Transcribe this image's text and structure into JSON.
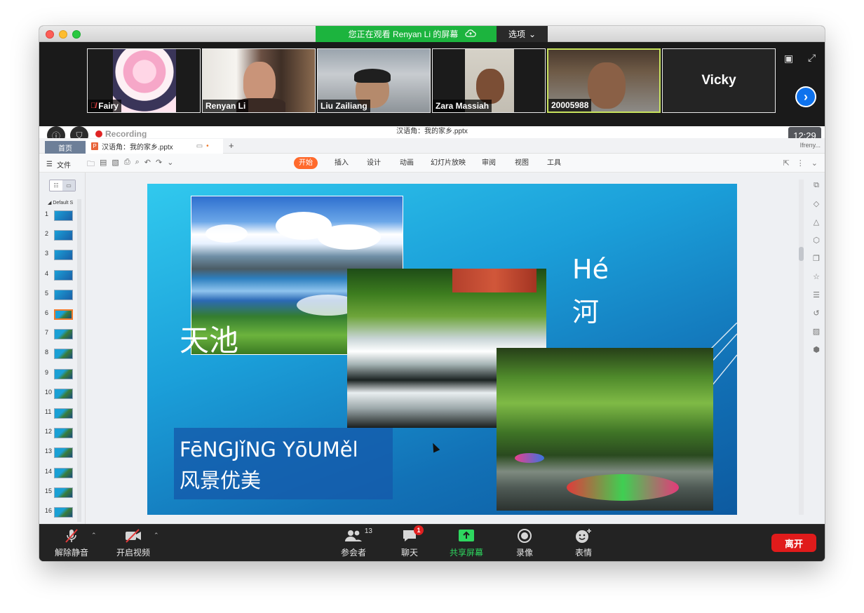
{
  "share_banner": {
    "text": "您正在观看 Renyan Li 的屏幕",
    "options_label": "选项"
  },
  "gallery": {
    "participants": [
      {
        "name": "Fairy",
        "muted": true
      },
      {
        "name": "Renyan Li",
        "muted": false
      },
      {
        "name": "Liu Zailiang",
        "muted": false
      },
      {
        "name": "Zara Massiah",
        "muted": false
      },
      {
        "name": "20005988",
        "muted": false
      },
      {
        "name": "Vicky",
        "muted": false
      }
    ]
  },
  "recording": {
    "label": "Recording"
  },
  "clock": "12:29",
  "wps": {
    "window_title": "汉语角：我的家乡.pptx",
    "home_tab": "首页",
    "doc_tab": "汉语角：我的家乡.pptx",
    "user": "Ifreny...",
    "file_menu": "文件",
    "ribbon_tabs": [
      "开始",
      "插入",
      "设计",
      "动画",
      "幻灯片放映",
      "审阅",
      "视图",
      "工具"
    ],
    "active_ribbon_tab": "开始",
    "section_label": "Default S",
    "thumbnails": [
      "1",
      "2",
      "3",
      "4",
      "5",
      "6",
      "7",
      "8",
      "9",
      "10",
      "11",
      "12",
      "13",
      "14",
      "15",
      "16"
    ],
    "selected_thumbnail": "6"
  },
  "slide": {
    "tianchi": "天池",
    "he_pinyin": "Hé",
    "he_char": "河",
    "pinyin_caption": "FēNGJǐNG YōUMěl",
    "caption": "风景优美"
  },
  "toolbar": {
    "unmute": "解除静音",
    "start_video": "开启视频",
    "participants": "参会者",
    "participants_count": "13",
    "chat": "聊天",
    "chat_badge": "1",
    "share_screen": "共享屏幕",
    "record": "录像",
    "reactions": "表情",
    "leave": "离开"
  },
  "colors": {
    "share_green": "#1cb43e",
    "leave_red": "#e01b1b",
    "wps_accent": "#ff6a2c",
    "active_speaker": "#c8e35d"
  }
}
